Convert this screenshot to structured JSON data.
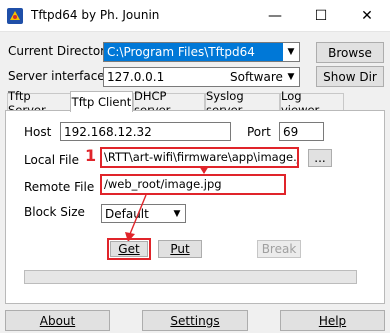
{
  "window": {
    "title": "Tftpd64 by Ph. Jounin",
    "minimize_glyph": "—",
    "maximize_glyph": "☐",
    "close_glyph": "✕"
  },
  "header": {
    "current_directory_label": "Current Directory",
    "current_directory_value": "C:\\Program Files\\Tftpd64",
    "browse_label": "Browse",
    "server_interfaces_label": "Server interfaces",
    "server_interface_value": "127.0.0.1",
    "server_interface_desc": "Software L",
    "show_dir_label": "Show Dir"
  },
  "tabs": [
    {
      "label": "Tftp Server"
    },
    {
      "label": "Tftp Client"
    },
    {
      "label": "DHCP server"
    },
    {
      "label": "Syslog server"
    },
    {
      "label": "Log viewer"
    }
  ],
  "client": {
    "host_label": "Host",
    "host_value": "192.168.12.32",
    "port_label": "Port",
    "port_value": "69",
    "local_file_label": "Local File",
    "local_file_value": "\\RTT\\art-wifi\\firmware\\app\\image.jpg",
    "browse_dots_label": "...",
    "remote_file_label": "Remote File",
    "remote_file_value": "/web_root/image.jpg",
    "block_size_label": "Block Size",
    "block_size_value": "Default",
    "get_label": "Get",
    "put_label": "Put",
    "break_label": "Break"
  },
  "annotation": {
    "step_number": "1",
    "color": "#e0242a"
  },
  "footer": {
    "about_label": "About",
    "settings_label": "Settings",
    "help_label": "Help"
  }
}
